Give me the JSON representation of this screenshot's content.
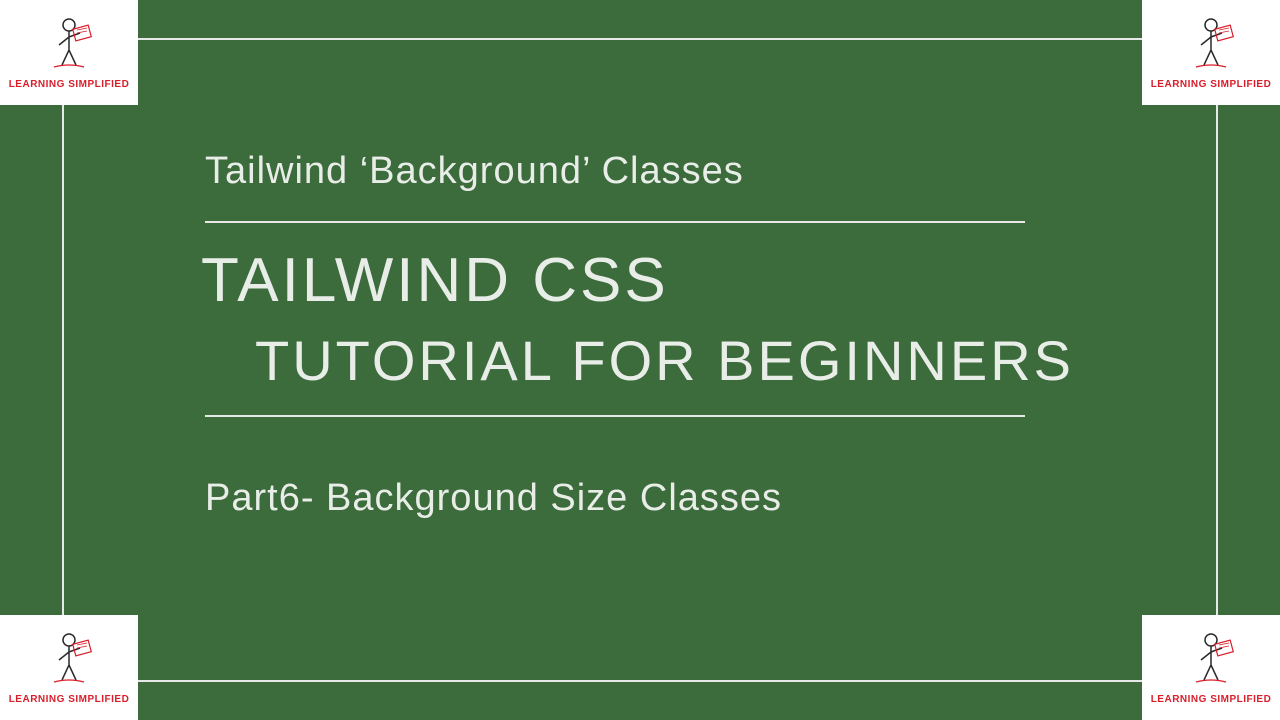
{
  "brand": {
    "name": "LEARNING SIMPLIFIED"
  },
  "slide": {
    "overline": "Tailwind ‘Background’ Classes",
    "title_line1": "TAILWIND CSS",
    "title_line2": "TUTORIAL FOR BEGINNERS",
    "subtitle": "Part6- Background Size Classes"
  },
  "colors": {
    "background": "#3c6b3c",
    "frame": "#e8e8e8",
    "text": "#e8ede8",
    "brand_red": "#d91e2a"
  }
}
